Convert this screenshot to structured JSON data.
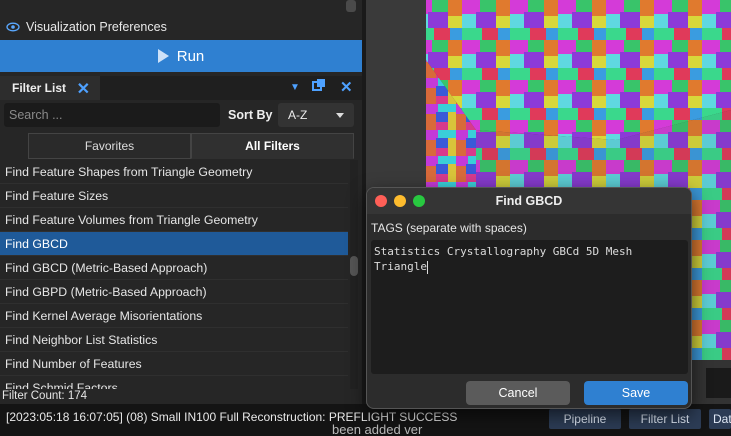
{
  "sidebar": {
    "visualization_label": "Visualization Preferences",
    "run_label": "Run"
  },
  "filter_list": {
    "title": "Filter List",
    "search_placeholder": "Search ...",
    "sort_label": "Sort By",
    "sort_value": "A-Z",
    "tabs": [
      {
        "label": "Favorites",
        "active": false
      },
      {
        "label": "All Filters",
        "active": true
      }
    ],
    "items": [
      {
        "label": "Find Feature Shapes from Triangle Geometry",
        "selected": false
      },
      {
        "label": "Find Feature Sizes",
        "selected": false
      },
      {
        "label": "Find Feature Volumes from Triangle Geometry",
        "selected": false
      },
      {
        "label": "Find GBCD",
        "selected": true
      },
      {
        "label": "Find GBCD (Metric-Based Approach)",
        "selected": false
      },
      {
        "label": "Find GBPD (Metric-Based Approach)",
        "selected": false
      },
      {
        "label": "Find Kernel Average Misorientations",
        "selected": false
      },
      {
        "label": "Find Neighbor List Statistics",
        "selected": false
      },
      {
        "label": "Find Number of Features",
        "selected": false
      },
      {
        "label": "Find Schmid Factors",
        "selected": false
      }
    ],
    "count_text": "Filter Count: 174"
  },
  "dialog": {
    "title": "Find GBCD",
    "tags_label": "TAGS (separate with spaces)",
    "tags_value": "Statistics Crystallography GBCd 5D Mesh Triangle",
    "cancel_label": "Cancel",
    "save_label": "Save"
  },
  "status": {
    "message": "[2023:05:18 16:07:05] (08) Small IN100 Full Reconstruction: PREFLIGHT SUCCESS",
    "buttons": [
      "Pipeline",
      "Filter List",
      "Dat"
    ],
    "peek_text": "been added ver"
  },
  "colors": {
    "accent": "#2f80d1",
    "selection": "#1f5a99",
    "dock_icon": "#4ea1ff"
  }
}
